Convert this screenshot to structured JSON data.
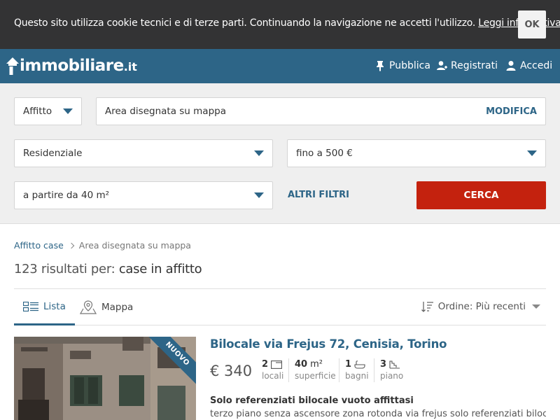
{
  "cookie": {
    "text": "Questo sito utilizza cookie tecnici e di terze parti. Continuando la navigazione ne accetti l'utilizzo.",
    "link": "Leggi informativa",
    "after_link": ".",
    "ok": "OK"
  },
  "header": {
    "logo_text": "immobiliare",
    "logo_tld": ".it",
    "nav": [
      {
        "label": "Pubblica",
        "icon": "pin-icon"
      },
      {
        "label": "Registrati",
        "icon": "add-user-icon"
      },
      {
        "label": "Accedi",
        "icon": "user-icon"
      }
    ]
  },
  "search": {
    "contract": "Affitto",
    "area": "Area disegnata su mappa",
    "modifica": "MODIFICA",
    "category": "Residenziale",
    "price": "fino a 500 €",
    "surface": "a partire da 40 m²",
    "more_filters": "ALTRI FILTRI",
    "submit": "CERCA"
  },
  "breadcrumb": {
    "root": "Affitto case",
    "current": "Area disegnata su mappa"
  },
  "results": {
    "prefix": "123 risultati per:",
    "query": "case in affitto"
  },
  "tabs": {
    "list": "Lista",
    "map": "Mappa",
    "sort": "Ordine: Più recenti"
  },
  "listing": {
    "badge": "NUOVO",
    "title": "Bilocale via Frejus 72, Cenisia, Torino",
    "price": "€ 340",
    "features": {
      "rooms_value": "2",
      "rooms_label": "locali",
      "surface_value": "40",
      "surface_unit": "m²",
      "surface_label": "superficie",
      "bath_value": "1",
      "bath_label": "bagni",
      "floor_value": "3",
      "floor_label": "piano"
    },
    "desc_title": "Solo referenziati bilocale vuoto affittasi",
    "desc": "terzo piano senza ascensore zona rotonda via frejus solo referenziati bilocale"
  },
  "colors": {
    "brand": "#2d6587",
    "cta": "#c4220e",
    "cookie_bg": "#333334"
  }
}
